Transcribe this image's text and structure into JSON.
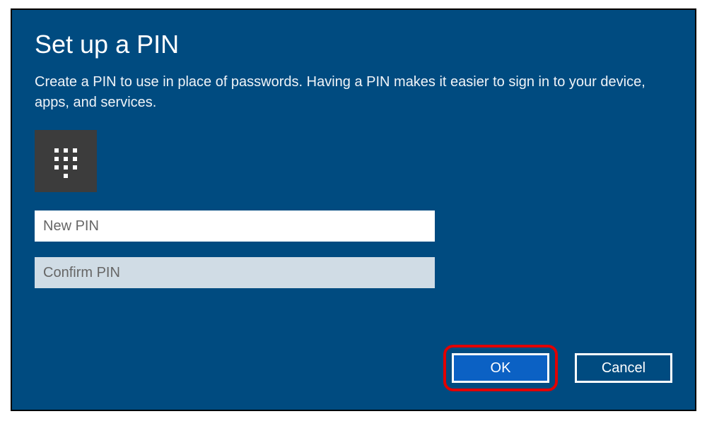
{
  "dialog": {
    "title": "Set up a PIN",
    "description": "Create a PIN to use in place of passwords. Having a PIN makes it easier to sign in to your device, apps, and services.",
    "icon": "pin-keypad",
    "fields": {
      "new_pin": {
        "placeholder": "New PIN",
        "value": ""
      },
      "confirm_pin": {
        "placeholder": "Confirm PIN",
        "value": ""
      }
    },
    "buttons": {
      "ok": "OK",
      "cancel": "Cancel"
    }
  },
  "colors": {
    "dialog_bg": "#004b80",
    "ok_bg": "#0b61c4",
    "highlight": "#e20000",
    "icon_bg": "#3c3c3c",
    "confirm_input_bg": "#d0dce5"
  }
}
